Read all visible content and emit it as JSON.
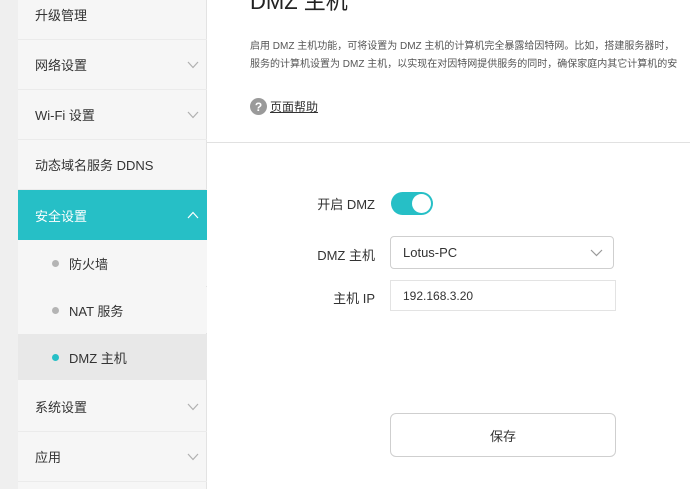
{
  "sidebar": {
    "items": [
      {
        "label": "升级管理",
        "has_chevron": false
      },
      {
        "label": "网络设置",
        "has_chevron": true
      },
      {
        "label": "Wi-Fi 设置",
        "has_chevron": true
      },
      {
        "label": "动态域名服务 DDNS",
        "has_chevron": false
      },
      {
        "label": "安全设置",
        "has_chevron": true,
        "expanded": true,
        "active": true
      },
      {
        "label": "系统设置",
        "has_chevron": true
      },
      {
        "label": "应用",
        "has_chevron": true
      }
    ],
    "sub_items": [
      {
        "label": "防火墙",
        "selected": false
      },
      {
        "label": "NAT 服务",
        "selected": false
      },
      {
        "label": "DMZ 主机",
        "selected": true
      }
    ]
  },
  "main": {
    "title": "DMZ 主机",
    "description_line1": "启用 DMZ 主机功能，可将设置为 DMZ 主机的计算机完全暴露给因特网。比如，搭建服务器时，",
    "description_line2": "服务的计算机设置为 DMZ 主机，以实现在对因特网提供服务的同时，确保家庭内其它计算机的安",
    "help_icon": "question-circle-icon",
    "help_text": "页面帮助",
    "form": {
      "enable_label": "开启 DMZ",
      "enable_value": true,
      "host_label": "DMZ 主机",
      "host_value": "Lotus-PC",
      "ip_label": "主机 IP",
      "ip_value": "192.168.3.20"
    },
    "save_label": "保存"
  },
  "colors": {
    "accent": "#26bfc6",
    "sidebar_bg": "#f6f6f6",
    "selected_bg": "#e8e8e8"
  }
}
